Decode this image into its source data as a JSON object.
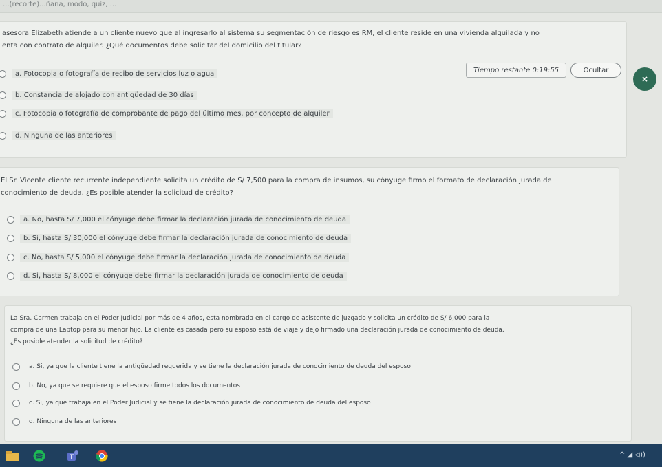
{
  "browser": {
    "tab_text": "...(recorte)...ñana, modo, quiz, ..."
  },
  "timer": {
    "text": "Tiempo restante 0:19:55"
  },
  "hide_button": {
    "label": "Ocultar"
  },
  "close_button": {
    "label": "×"
  },
  "questions": [
    {
      "lines": [
        "asesora Elizabeth atiende a un cliente nuevo que al ingresarlo al sistema su segmentación de riesgo es RM, el cliente reside en una vivienda alquilada y no",
        "enta con contrato de alquiler. ¿Qué documentos debe solicitar del domicilio del titular?"
      ],
      "options": [
        "a.  Fotocopia o fotografía de recibo de servicios luz o agua",
        "b.  Constancia de alojado con antigüedad de 30 días",
        "c.  Fotocopia o fotografía de comprobante de pago del último mes, por concepto de alquiler",
        "d.  Ninguna de las anteriores"
      ]
    },
    {
      "lines": [
        "El Sr. Vicente cliente recurrente independiente solicita un crédito de S/ 7,500 para la compra de insumos, su cónyuge firmo el formato de declaración jurada de",
        "conocimiento de deuda. ¿Es posible atender la solicitud de crédito?"
      ],
      "options": [
        "a.  No, hasta S/ 7,000 el cónyuge debe firmar la declaración jurada de conocimiento de deuda",
        "b.  Si, hasta S/ 30,000 el cónyuge debe firmar la declaración jurada de conocimiento de deuda",
        "c.  No, hasta S/ 5,000 el cónyuge debe firmar la declaración jurada de conocimiento de deuda",
        "d.  Si, hasta S/ 8,000 el cónyuge debe firmar la declaración jurada de conocimiento de deuda"
      ]
    },
    {
      "lines": [
        "La Sra. Carmen trabaja en el Poder Judicial por más de 4 años, esta nombrada en el cargo de asistente de juzgado y solicita un crédito de S/ 6,000 para la",
        "compra de una Laptop para su menor hijo. La cliente es casada pero su esposo está de viaje y dejo firmado una declaración jurada de conocimiento de deuda.",
        "¿Es posible atender la solicitud de crédito?"
      ],
      "options": [
        "a.  Si, ya que la cliente tiene la antigüedad requerida y se tiene la declaración jurada de conocimiento de deuda del esposo",
        "b.  No, ya que se requiere que el esposo firme todos los documentos",
        "c.  Si, ya que trabaja en el Poder Judicial y se tiene la declaración jurada de conocimiento de deuda del esposo",
        "d.  Ninguna de las anteriores"
      ]
    }
  ],
  "taskbar": {
    "tray_text": "^  ◢  ◁))",
    "colors": {
      "bar": "#1f3f5e",
      "spotify": "#1db954",
      "teams": "#5b6ec9",
      "chrome": "#db4437"
    }
  }
}
